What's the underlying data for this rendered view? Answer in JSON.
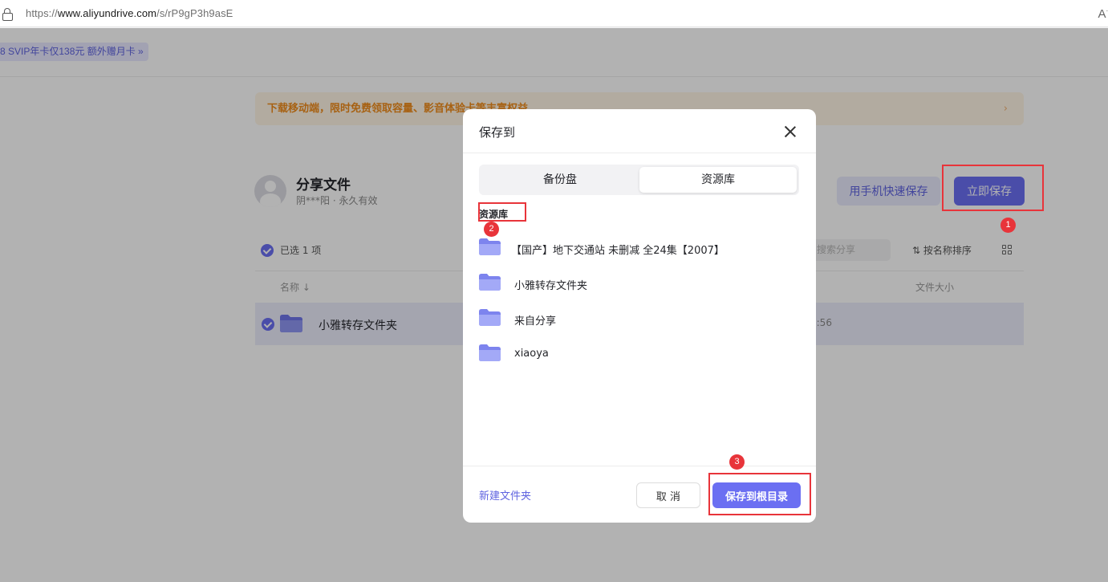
{
  "browser": {
    "url_prefix": "https://",
    "url_host": "www.aliyundrive.com",
    "url_path": "/s/rP9gP3h9asE",
    "read_aloud_glyph": "Aͅ"
  },
  "promo": {
    "text": "8 SVIP年卡仅138元 额外赠月卡 »"
  },
  "banner": {
    "text": "下载移动端，限时免费领取容量、影音体验卡等丰富权益",
    "arrow": "›"
  },
  "share": {
    "title": "分享文件",
    "meta": "阴***阳 · 永久有效",
    "phone_save_label": "用手机快速保存",
    "save_now_label": "立即保存"
  },
  "toolbar": {
    "selected_text": "已选 1 项",
    "search_placeholder": "搜索分享",
    "sort_label": "按名称排序"
  },
  "table": {
    "col_name": "名称",
    "col_size": "文件大小",
    "row": {
      "name": "小雅转存文件夹",
      "time": "3:56"
    }
  },
  "annotations": {
    "badge1": "1",
    "badge2": "2",
    "badge3": "3"
  },
  "modal": {
    "title": "保存到",
    "tabs": [
      {
        "label": "备份盘",
        "active": false
      },
      {
        "label": "资源库",
        "active": true
      }
    ],
    "breadcrumb": "资源库",
    "folders": [
      {
        "name": "【国产】地下交通站 未删减 全24集【2007】"
      },
      {
        "name": "小雅转存文件夹"
      },
      {
        "name": "来自分享"
      },
      {
        "name": "xiaoya"
      }
    ],
    "new_folder_label": "新建文件夹",
    "cancel_label": "取 消",
    "save_root_label": "保存到根目录"
  },
  "colors": {
    "accent": "#6b6ff2",
    "annotation": "#e8343a",
    "folder": "#8e95f3"
  }
}
